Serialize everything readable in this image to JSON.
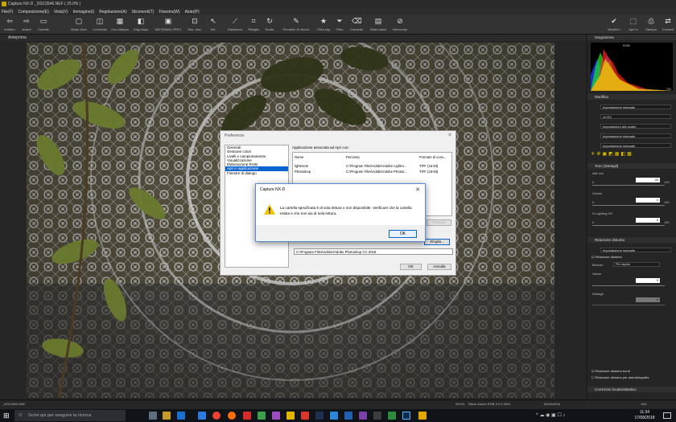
{
  "window": {
    "title": "Capture NX-D   _DSC0546.NEF ( 25.0% )"
  },
  "menu": [
    "File(F)",
    "Composizione(E)",
    "Vista(V)",
    "Immagine(I)",
    "Regolazione(A)",
    "Strumenti(T)",
    "Finestra(W)",
    "Aiuto(P)"
  ],
  "toolbar": {
    "items": [
      {
        "label": "Indietro",
        "icon": "back-arrow-icon"
      },
      {
        "label": "Avanti",
        "icon": "forward-arrow-icon"
      },
      {
        "label": "Cartelle",
        "icon": "folder-icon"
      },
      {
        "label": "Modo visor",
        "icon": "view-mode-icon"
      },
      {
        "label": "Confronta",
        "icon": "compare-icon"
      },
      {
        "label": "Con.stampa",
        "icon": "contact-sheet-icon"
      },
      {
        "label": "Orig./dopo",
        "icon": "before-after-icon"
      },
      {
        "label": "NEF(RAW)+JPEG",
        "icon": "nef-jpeg-icon"
      },
      {
        "label": "Strs. visu.",
        "icon": "display-icon"
      },
      {
        "label": "Sel.",
        "icon": "select-icon"
      },
      {
        "label": "Raddrizza",
        "icon": "straighten-icon"
      },
      {
        "label": "Ritaglia",
        "icon": "crop-icon"
      },
      {
        "label": "Ruota",
        "icon": "rotate-icon"
      },
      {
        "label": "Pennello di ritocco",
        "icon": "retouch-brush-icon"
      },
      {
        "label": "Filtro tag",
        "icon": "star-icon"
      },
      {
        "label": "Filtro",
        "icon": "filter-icon"
      },
      {
        "label": "Cancella",
        "icon": "delete-icon"
      },
      {
        "label": "Stato batch",
        "icon": "batch-status-icon"
      },
      {
        "label": "Interrompi",
        "icon": "stop-icon"
      }
    ],
    "right_items": [
      {
        "label": "ViewNX-i",
        "icon": "viewnx-icon"
      },
      {
        "label": "Apri in",
        "icon": "open-in-icon"
      },
      {
        "label": "Stampa",
        "icon": "print-icon"
      },
      {
        "label": "Converti",
        "icon": "convert-icon"
      }
    ]
  },
  "viewer": {
    "header": "Anteprima"
  },
  "right_panel": {
    "histogram": {
      "header": "Istogramma",
      "channel": "RGB",
      "max_value": "255"
    },
    "edit": {
      "header": "Modifica",
      "rows": [
        "Impostazione manuale",
        "±0 EV",
        "Impostazioni allo scatto",
        "Impostazione manuale",
        "Impostazione manuale"
      ]
    },
    "tone": {
      "header": "Tono (Dettagli)",
      "highlights": {
        "label": "Alte luci",
        "value": "20",
        "min": "0",
        "max": "100"
      },
      "shadows": {
        "label": "Ombre",
        "value": "0",
        "min": "0",
        "max": "100"
      },
      "dlighting": {
        "label": "D-Lighting HS",
        "value": "0",
        "min": "0",
        "max": "100"
      }
    },
    "noise": {
      "header": "Riduzione disturbo",
      "preset": "Impostazione manuale",
      "checkbox": "Riduzione disturbo",
      "method_label": "Metodo",
      "method_value": "Più rapido",
      "value_label": "Valore",
      "value": "0",
      "detail_label": "Dettagli",
      "detail_value": "0",
      "edge_nr": "Riduzione disturbo bordi",
      "astro_nr": "Riduzione disturbo per astrofotografia"
    },
    "lens": {
      "header": "Correzioni focale/obiettivo"
    }
  },
  "status": {
    "filename": "_DSC0546.NEF",
    "zoom": "25.0%",
    "profile": "Nikon Adobe RGB 4.0.0.3001",
    "size": "6016x4016",
    "page": "1/81"
  },
  "preferences": {
    "title": "Preferenze",
    "categories": [
      "Generali",
      "Gestione colori",
      "Livelli e campionamento",
      "Visualizzazione",
      "Elaborazione RAW",
      "Apri in applicazione",
      "Finestre di dialogo"
    ],
    "selected_index": 5,
    "section_title": "Applicazione associata ad Apri con:",
    "columns": [
      "Nome",
      "Percorso",
      "Formato di conv..."
    ],
    "rows": [
      {
        "name": "lightroom",
        "path": "C:\\Program Files\\Adobe\\Adobe Lightro...",
        "format": "TIFF (16-bit)"
      },
      {
        "name": "Photoshop",
        "path": "C:\\Program Files\\Adobe\\Adobe Photos...",
        "format": "TIFF (16-bit)"
      }
    ],
    "remove_label": "Rimuovi",
    "browse_label": "Sfoglia...",
    "path_value": "C:\\Program Files\\Adobe\\Adobe Photoshop CC 2018",
    "ok_label": "OK",
    "cancel_label": "Annulla"
  },
  "alert": {
    "title": "Capture NX-D",
    "message": "La cartella specificata è di sola lettura o non disponibile. Verificare che la cartella esista e che non sia di sola lettura.",
    "ok_label": "OK"
  },
  "taskbar": {
    "search_placeholder": "Scrivi qui per eseguire la ricerca",
    "time": "11:34",
    "date": "17/08/2018"
  },
  "colors": {
    "accent": "#0a64d0",
    "warning": "#f2c500",
    "app_bg": "#1e1e1e"
  }
}
